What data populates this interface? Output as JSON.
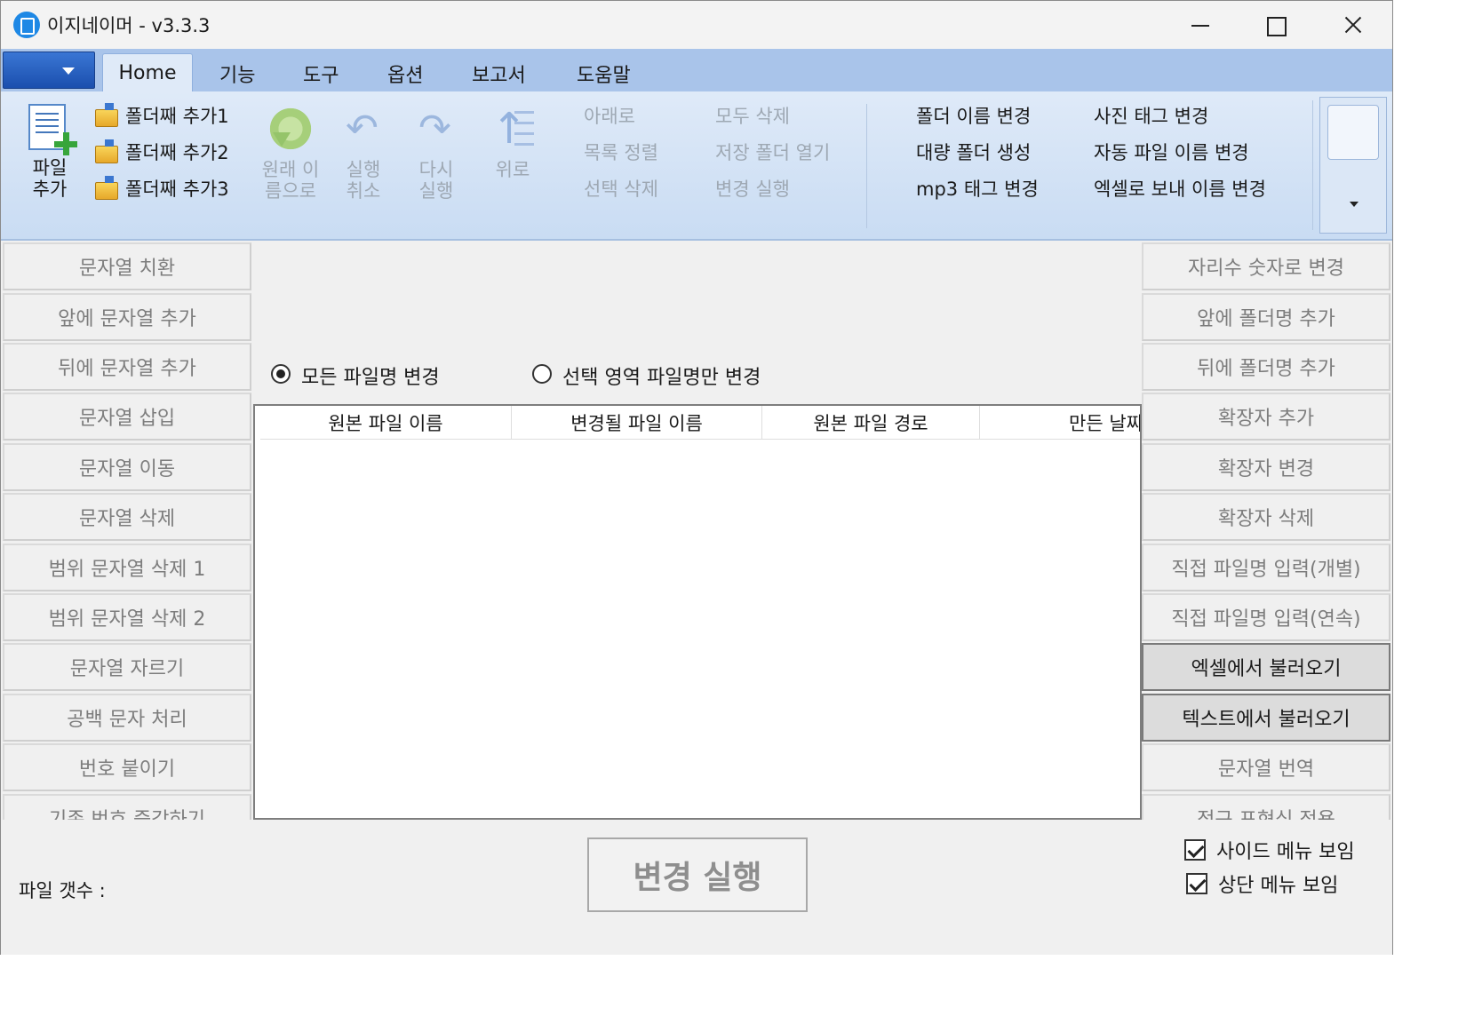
{
  "window": {
    "title": "이지네이머 - v3.3.3"
  },
  "tabs": {
    "home": "Home",
    "items": [
      "기능",
      "도구",
      "옵션",
      "보고서",
      "도움말"
    ]
  },
  "ribbon": {
    "add_file": "파일\n추가",
    "add_folder": [
      "폴더째 추가1",
      "폴더째 추가2",
      "폴더째 추가3"
    ],
    "restore": "원래 이\n름으로",
    "undo": "실행\n취소",
    "redo": "다시\n실행",
    "up": "위로",
    "col1": [
      "아래로",
      "목록 정렬",
      "선택 삭제"
    ],
    "col2": [
      "모두 삭제",
      "저장 폴더 열기",
      "변경 실행"
    ],
    "col3": [
      "폴더 이름 변경",
      "대량 폴더 생성",
      "mp3 태그 변경"
    ],
    "col4": [
      "사진 태그 변경",
      "자동 파일 이름 변경",
      "엑셀로 보내 이름 변경"
    ]
  },
  "left_menu": [
    "문자열 치환",
    "앞에 문자열 추가",
    "뒤에 문자열 추가",
    "문자열 삽입",
    "문자열 이동",
    "문자열 삭제",
    "범위 문자열 삭제 1",
    "범위 문자열 삭제 2",
    "문자열 자르기",
    "공백 문자 처리",
    "번호 붙이기",
    "기존 번호 증감하기"
  ],
  "right_menu": [
    "자리수 숫자로 변경",
    "앞에 폴더명 추가",
    "뒤에 폴더명 추가",
    "확장자 추가",
    "확장자 변경",
    "확장자 삭제",
    "직접 파일명 입력(개별)",
    "직접 파일명 입력(연속)",
    "엑셀에서 불러오기",
    "텍스트에서 불러오기",
    "문자열 번역",
    "정규 표현식 적용"
  ],
  "mode": {
    "all": "모든 파일명 변경",
    "selected": "선택 영역 파일명만 변경"
  },
  "grid": {
    "columns": [
      "원본 파일 이름",
      "변경될 파일 이름",
      "원본 파일 경로",
      "만든 날짜"
    ]
  },
  "bottom": {
    "file_count": "파일 갯수 :",
    "run": "변경 실행",
    "show_side": "사이드 메뉴 보임",
    "show_top": "상단 메뉴 보임"
  }
}
